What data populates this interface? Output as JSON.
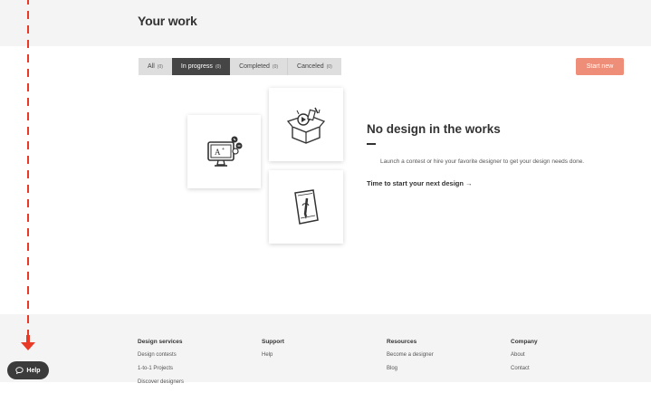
{
  "header": {
    "title": "Your work"
  },
  "tabs": [
    {
      "label": "All",
      "count": "(0)"
    },
    {
      "label": "In progress",
      "count": "(0)"
    },
    {
      "label": "Completed",
      "count": "(0)"
    },
    {
      "label": "Canceled",
      "count": "(0)"
    }
  ],
  "active_tab": "In progress",
  "start_button": {
    "label": "Start new",
    "color": "#ef8e78"
  },
  "empty_state": {
    "title": "No design in the works",
    "description": "Launch a contest or hire your favorite designer to get your design needs done.",
    "link": "Time to start your next design →",
    "illustrations": [
      "monitor-design-icon",
      "open-box-icon",
      "document-pen-icon"
    ]
  },
  "footer": {
    "columns": [
      {
        "heading": "Design services",
        "links": [
          "Design contests",
          "1-to-1 Projects",
          "Discover designers"
        ]
      },
      {
        "heading": "Support",
        "links": [
          "Help"
        ]
      },
      {
        "heading": "Resources",
        "links": [
          "Become a designer",
          "Blog"
        ]
      },
      {
        "heading": "Company",
        "links": [
          "About",
          "Contact"
        ]
      }
    ]
  },
  "help_button": {
    "label": "Help",
    "icon": "speech-bubble-icon"
  },
  "annotation": {
    "color": "#e83a26"
  }
}
